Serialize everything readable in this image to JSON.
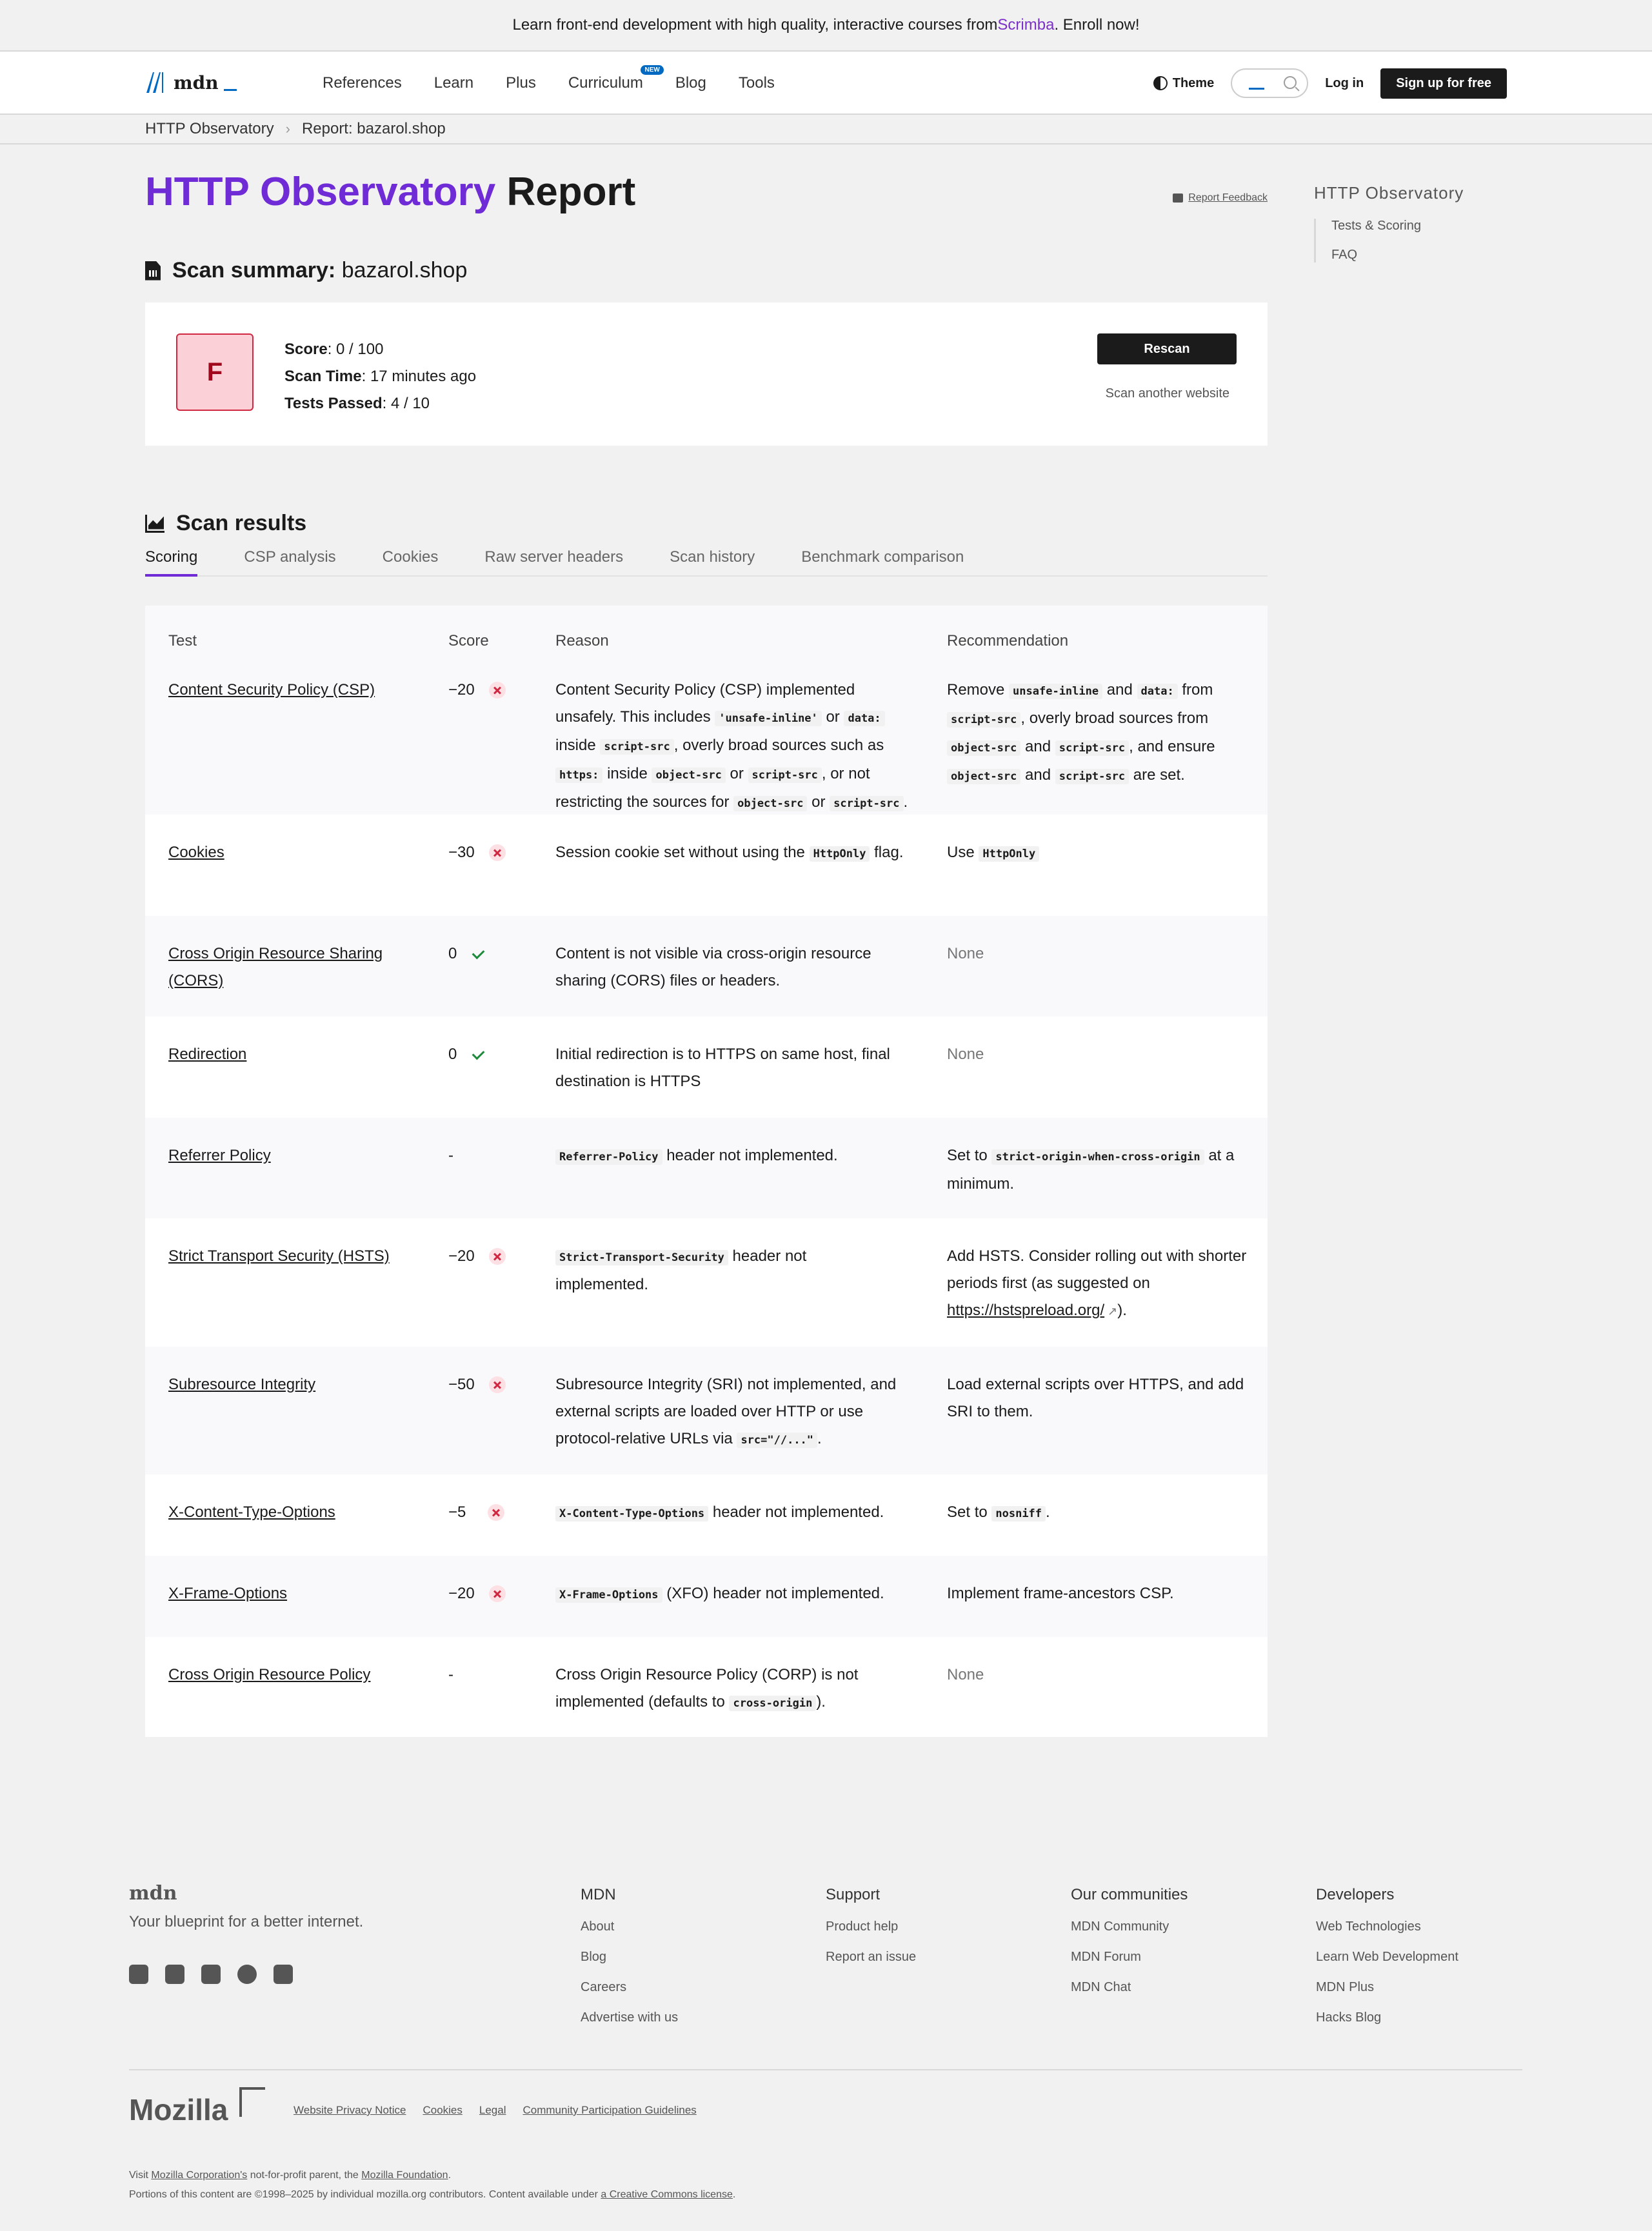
{
  "banner": {
    "prefix": "Learn front-end development with high quality, interactive courses from ",
    "brand": "Scrimba",
    "suffix": ". Enroll now!"
  },
  "nav": {
    "logo_text": "mdn",
    "items": [
      "References",
      "Learn",
      "Plus",
      "Curriculum",
      "Blog",
      "Tools"
    ],
    "new_badge": "NEW",
    "theme": "Theme",
    "login": "Log in",
    "signup": "Sign up for free"
  },
  "breadcrumbs": [
    "HTTP Observatory",
    "Report: bazarol.shop"
  ],
  "page": {
    "title_accent": "HTTP Observatory",
    "title_rest": " Report",
    "feedback": "Report Feedback"
  },
  "summary": {
    "heading": "Scan summary:",
    "site": "bazarol.shop",
    "grade": "F",
    "score_label": "Score",
    "score_value": ": 0 / 100",
    "time_label": "Scan Time",
    "time_value": ": 17 minutes ago",
    "passed_label": "Tests Passed",
    "passed_value": ": 4 / 10",
    "rescan": "Rescan",
    "scan_another": "Scan another website"
  },
  "results": {
    "heading": "Scan results",
    "tabs": [
      "Scoring",
      "CSP analysis",
      "Cookies",
      "Raw server headers",
      "Scan history",
      "Benchmark comparison"
    ],
    "columns": [
      "Test",
      "Score",
      "Reason",
      "Recommendation"
    ],
    "rows": [
      {
        "test": "Content Security Policy (CSP)",
        "score": "−20",
        "status": "fail"
      },
      {
        "test": "Cookies",
        "score": "−30",
        "status": "fail"
      },
      {
        "test": "Cross Origin Resource Sharing (CORS)",
        "score": "0",
        "status": "pass"
      },
      {
        "test": "Redirection",
        "score": "0",
        "status": "pass"
      },
      {
        "test": "Referrer Policy",
        "score": "-",
        "status": "none"
      },
      {
        "test": "Strict Transport Security (HSTS)",
        "score": "−20",
        "status": "fail"
      },
      {
        "test": "Subresource Integrity",
        "score": "−50",
        "status": "fail"
      },
      {
        "test": "X-Content-Type-Options",
        "score": "−5",
        "status": "fail"
      },
      {
        "test": "X-Frame-Options",
        "score": "−20",
        "status": "fail"
      },
      {
        "test": "Cross Origin Resource Policy",
        "score": "-",
        "status": "none"
      }
    ],
    "text": {
      "r0_reason_a": "Content Security Policy (CSP) implemented unsafely. This includes ",
      "r0_code1": "'unsafe-inline'",
      "r0_or1": " or ",
      "r0_code2": "data:",
      "r0_inside1": " inside ",
      "r0_code3": "script-src",
      "r0_reason_b": ", overly broad sources such as ",
      "r0_code4": "https:",
      "r0_inside2": " inside ",
      "r0_code5": "object-src",
      "r0_or2": " or ",
      "r0_code6": "script-src",
      "r0_reason_c": ", or not restricting the sources for ",
      "r0_code7": "object-src",
      "r0_or3": " or ",
      "r0_code8": "script-src",
      "r0_dot": ".",
      "r0_rec_a": "Remove ",
      "r0_rec_code1": "unsafe-inline",
      "r0_rec_and1": " and ",
      "r0_rec_code2": "data:",
      "r0_rec_from": " from ",
      "r0_rec_code3": "script-src",
      "r0_rec_b": ", overly broad sources from ",
      "r0_rec_code4": "object-src",
      "r0_rec_and2": " and ",
      "r0_rec_code5": "script-src",
      "r0_rec_c": ", and ensure ",
      "r0_rec_code6": "object-src",
      "r0_rec_and3": " and ",
      "r0_rec_code7": "script-src",
      "r0_rec_d": " are set.",
      "r1_reason_a": "Session cookie set without using the ",
      "r1_code": "HttpOnly",
      "r1_reason_b": " flag.",
      "r1_rec_a": "Use ",
      "r1_rec_code": "HttpOnly",
      "r2_reason": "Content is not visible via cross-origin resource sharing (CORS) files or headers.",
      "r2_rec": "None",
      "r3_reason": "Initial redirection is to HTTPS on same host, final destination is HTTPS",
      "r3_rec": "None",
      "r4_code": "Referrer-Policy",
      "r4_reason": " header not implemented.",
      "r4_rec_a": "Set to ",
      "r4_rec_code": "strict-origin-when-cross-origin",
      "r4_rec_b": " at a minimum.",
      "r5_code": "Strict-Transport-Security",
      "r5_reason": " header not implemented.",
      "r5_rec_a": "Add HSTS. Consider rolling out with shorter periods first (as suggested on ",
      "r5_rec_link": "https://hstspreload.org/",
      "r5_rec_b": ").",
      "r6_reason_a": "Subresource Integrity (SRI) not implemented, and external scripts are loaded over HTTP or use protocol-relative URLs via ",
      "r6_code": "src=\"//...\"",
      "r6_reason_b": ".",
      "r6_rec": "Load external scripts over HTTPS, and add SRI to them.",
      "r7_code": "X-Content-Type-Options",
      "r7_reason": " header not implemented.",
      "r7_rec_a": "Set to ",
      "r7_rec_code": "nosniff",
      "r7_rec_b": ".",
      "r8_code": "X-Frame-Options",
      "r8_reason": " (XFO) header not implemented.",
      "r8_rec": "Implement frame-ancestors CSP.",
      "r9_reason_a": "Cross Origin Resource Policy (CORP) is not implemented (defaults to ",
      "r9_code": "cross-origin",
      "r9_reason_b": ").",
      "r9_rec": "None"
    }
  },
  "sidebar": {
    "title": "HTTP Observatory",
    "items": [
      "Tests & Scoring",
      "FAQ"
    ]
  },
  "footer": {
    "logo": "mdn",
    "tagline": "Your blueprint for a better internet.",
    "social": [
      "bluesky-icon",
      "mastodon-icon",
      "x-icon",
      "github-icon",
      "rss-icon"
    ],
    "columns": [
      {
        "title": "MDN",
        "links": [
          "About",
          "Blog",
          "Careers",
          "Advertise with us"
        ]
      },
      {
        "title": "Support",
        "links": [
          "Product help",
          "Report an issue"
        ]
      },
      {
        "title": "Our communities",
        "links": [
          "MDN Community",
          "MDN Forum",
          "MDN Chat"
        ]
      },
      {
        "title": "Developers",
        "links": [
          "Web Technologies",
          "Learn Web Development",
          "MDN Plus",
          "Hacks Blog"
        ]
      }
    ],
    "mozilla": "Mozilla",
    "legal": [
      "Website Privacy Notice",
      "Cookies",
      "Legal",
      "Community Participation Guidelines"
    ],
    "fine1_a": "Visit ",
    "fine1_link1": "Mozilla Corporation's",
    "fine1_b": " not-for-profit parent, the ",
    "fine1_link2": "Mozilla Foundation",
    "fine1_c": ".",
    "fine2_a": "Portions of this content are ©1998–2025 by individual mozilla.org contributors. Content available under ",
    "fine2_link": "a Creative Commons license",
    "fine2_b": "."
  }
}
